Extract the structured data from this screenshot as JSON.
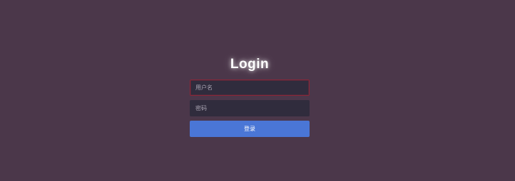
{
  "login": {
    "title": "Login",
    "username_placeholder": "用户名",
    "password_placeholder": "密码",
    "submit_label": "登录"
  },
  "colors": {
    "background": "#4b374a",
    "input_background": "#302c3d",
    "active_input_border": "#8a2638",
    "button": "#4a76d6",
    "title_text": "#ffffff"
  }
}
